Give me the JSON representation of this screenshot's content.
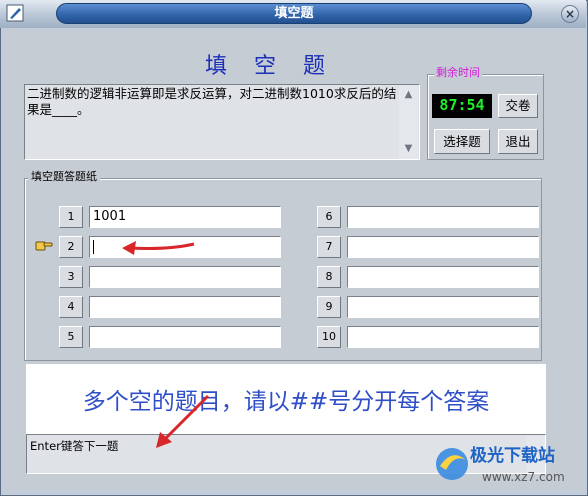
{
  "window": {
    "title": "填空题",
    "close_glyph": "×"
  },
  "heading": "填 空 题",
  "question": {
    "text": "二进制数的逻辑非运算即是求反运算，对二进制数1010求反后的结果是____。",
    "scroll_up": "▲",
    "scroll_down": "▼"
  },
  "timer": {
    "label": "剩余时间",
    "value": "87:54"
  },
  "buttons": {
    "submit": "交卷",
    "choice": "选择题",
    "exit": "退出"
  },
  "answer_sheet": {
    "label": "填空题答题纸",
    "left_items": [
      {
        "number": "1",
        "value": "1001"
      },
      {
        "number": "2",
        "value": ""
      },
      {
        "number": "3",
        "value": ""
      },
      {
        "number": "4",
        "value": ""
      },
      {
        "number": "5",
        "value": ""
      }
    ],
    "right_items": [
      {
        "number": "6",
        "value": ""
      },
      {
        "number": "7",
        "value": ""
      },
      {
        "number": "8",
        "value": ""
      },
      {
        "number": "9",
        "value": ""
      },
      {
        "number": "10",
        "value": ""
      }
    ],
    "active_index": 2,
    "pointer_icon": "hand-pointer-icon"
  },
  "banner": "多个空的题目，请以##号分开每个答案",
  "status": "Enter键答下一题",
  "watermark": {
    "logo_text": "极光下载站",
    "url": "www.xz7.com"
  },
  "colors": {
    "title_bar": "#2f62a8",
    "heading": "#1c2fb8",
    "timer_label": "#d21ad8",
    "timer_digits": "#1ef02a",
    "banner_text": "#2f4fc8",
    "annotation_arrow": "#d8262a"
  }
}
